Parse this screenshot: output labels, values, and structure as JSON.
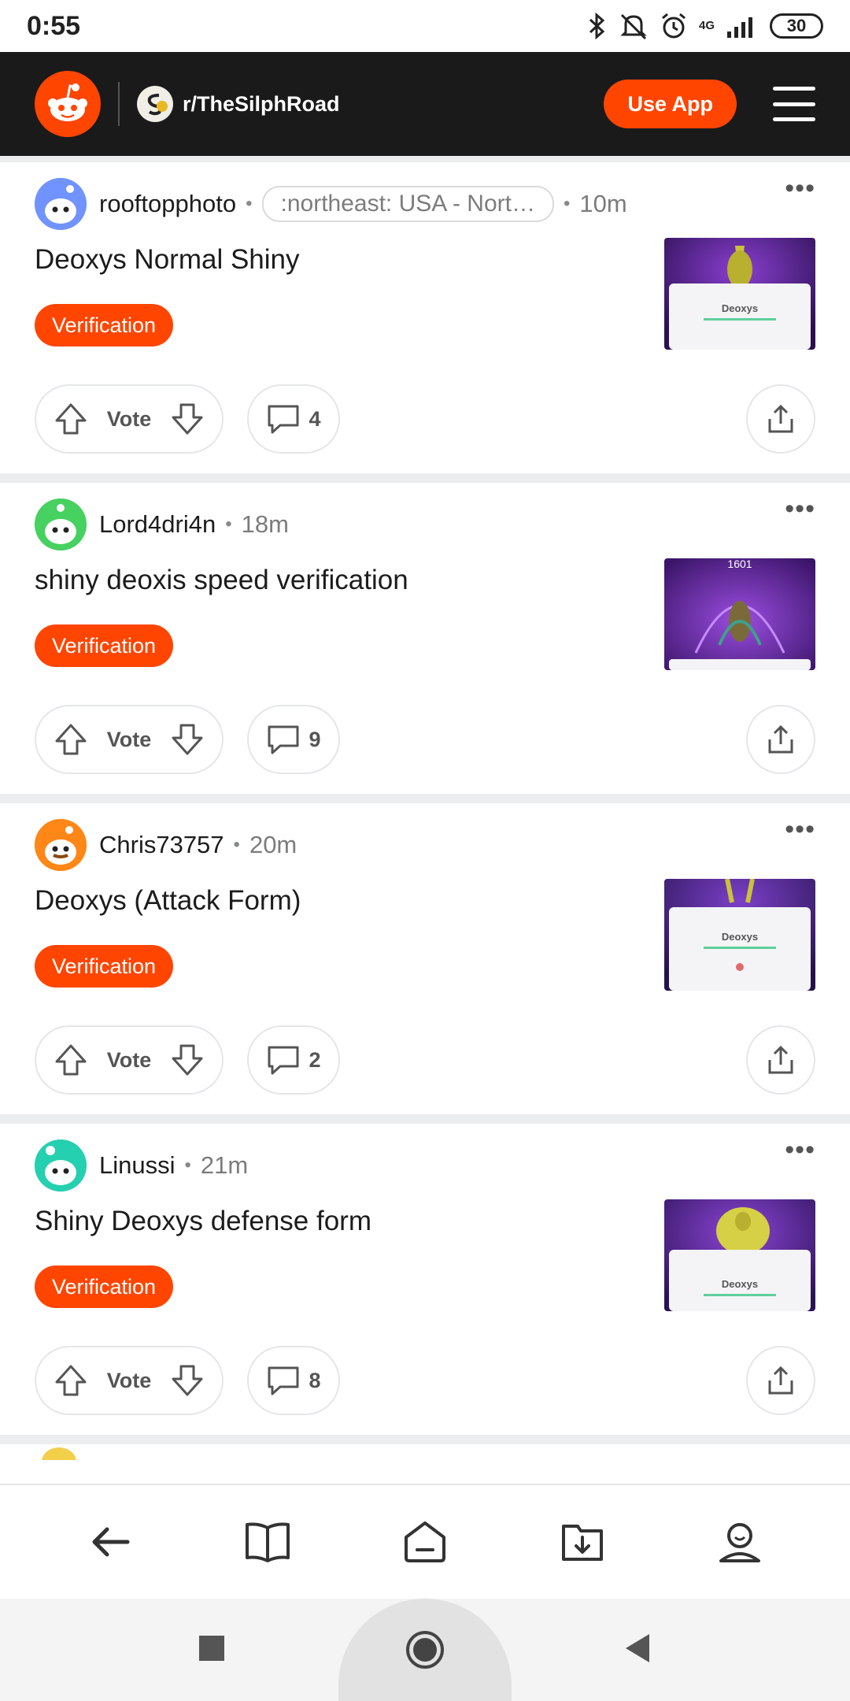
{
  "status_bar": {
    "time": "0:55",
    "network": "4G",
    "battery": "30"
  },
  "header": {
    "subreddit": "r/TheSilphRoad",
    "use_app_label": "Use App"
  },
  "posts": [
    {
      "author": "rooftopphoto",
      "flair": ":northeast: USA - Nort…",
      "age": "10m",
      "title": "Deoxys Normal Shiny",
      "tag": "Verification",
      "vote_label": "Vote",
      "comments": "4",
      "thumb_label": "Deoxys",
      "avatar_color": "#7193ff"
    },
    {
      "author": "Lord4dri4n",
      "flair": "",
      "age": "18m",
      "title": "shiny deoxis speed verification",
      "tag": "Verification",
      "vote_label": "Vote",
      "comments": "9",
      "thumb_label": "1601",
      "avatar_color": "#46d160"
    },
    {
      "author": "Chris73757",
      "flair": "",
      "age": "20m",
      "title": "Deoxys (Attack Form)",
      "tag": "Verification",
      "vote_label": "Vote",
      "comments": "2",
      "thumb_label": "Deoxys",
      "avatar_color": "#ff8717"
    },
    {
      "author": "Linussi",
      "flair": "",
      "age": "21m",
      "title": "Shiny Deoxys defense form",
      "tag": "Verification",
      "vote_label": "Vote",
      "comments": "8",
      "thumb_label": "Deoxys",
      "avatar_color": "#24a0a0"
    }
  ],
  "colors": {
    "accent": "#ff4500",
    "header_bg": "#1a1a1b"
  }
}
